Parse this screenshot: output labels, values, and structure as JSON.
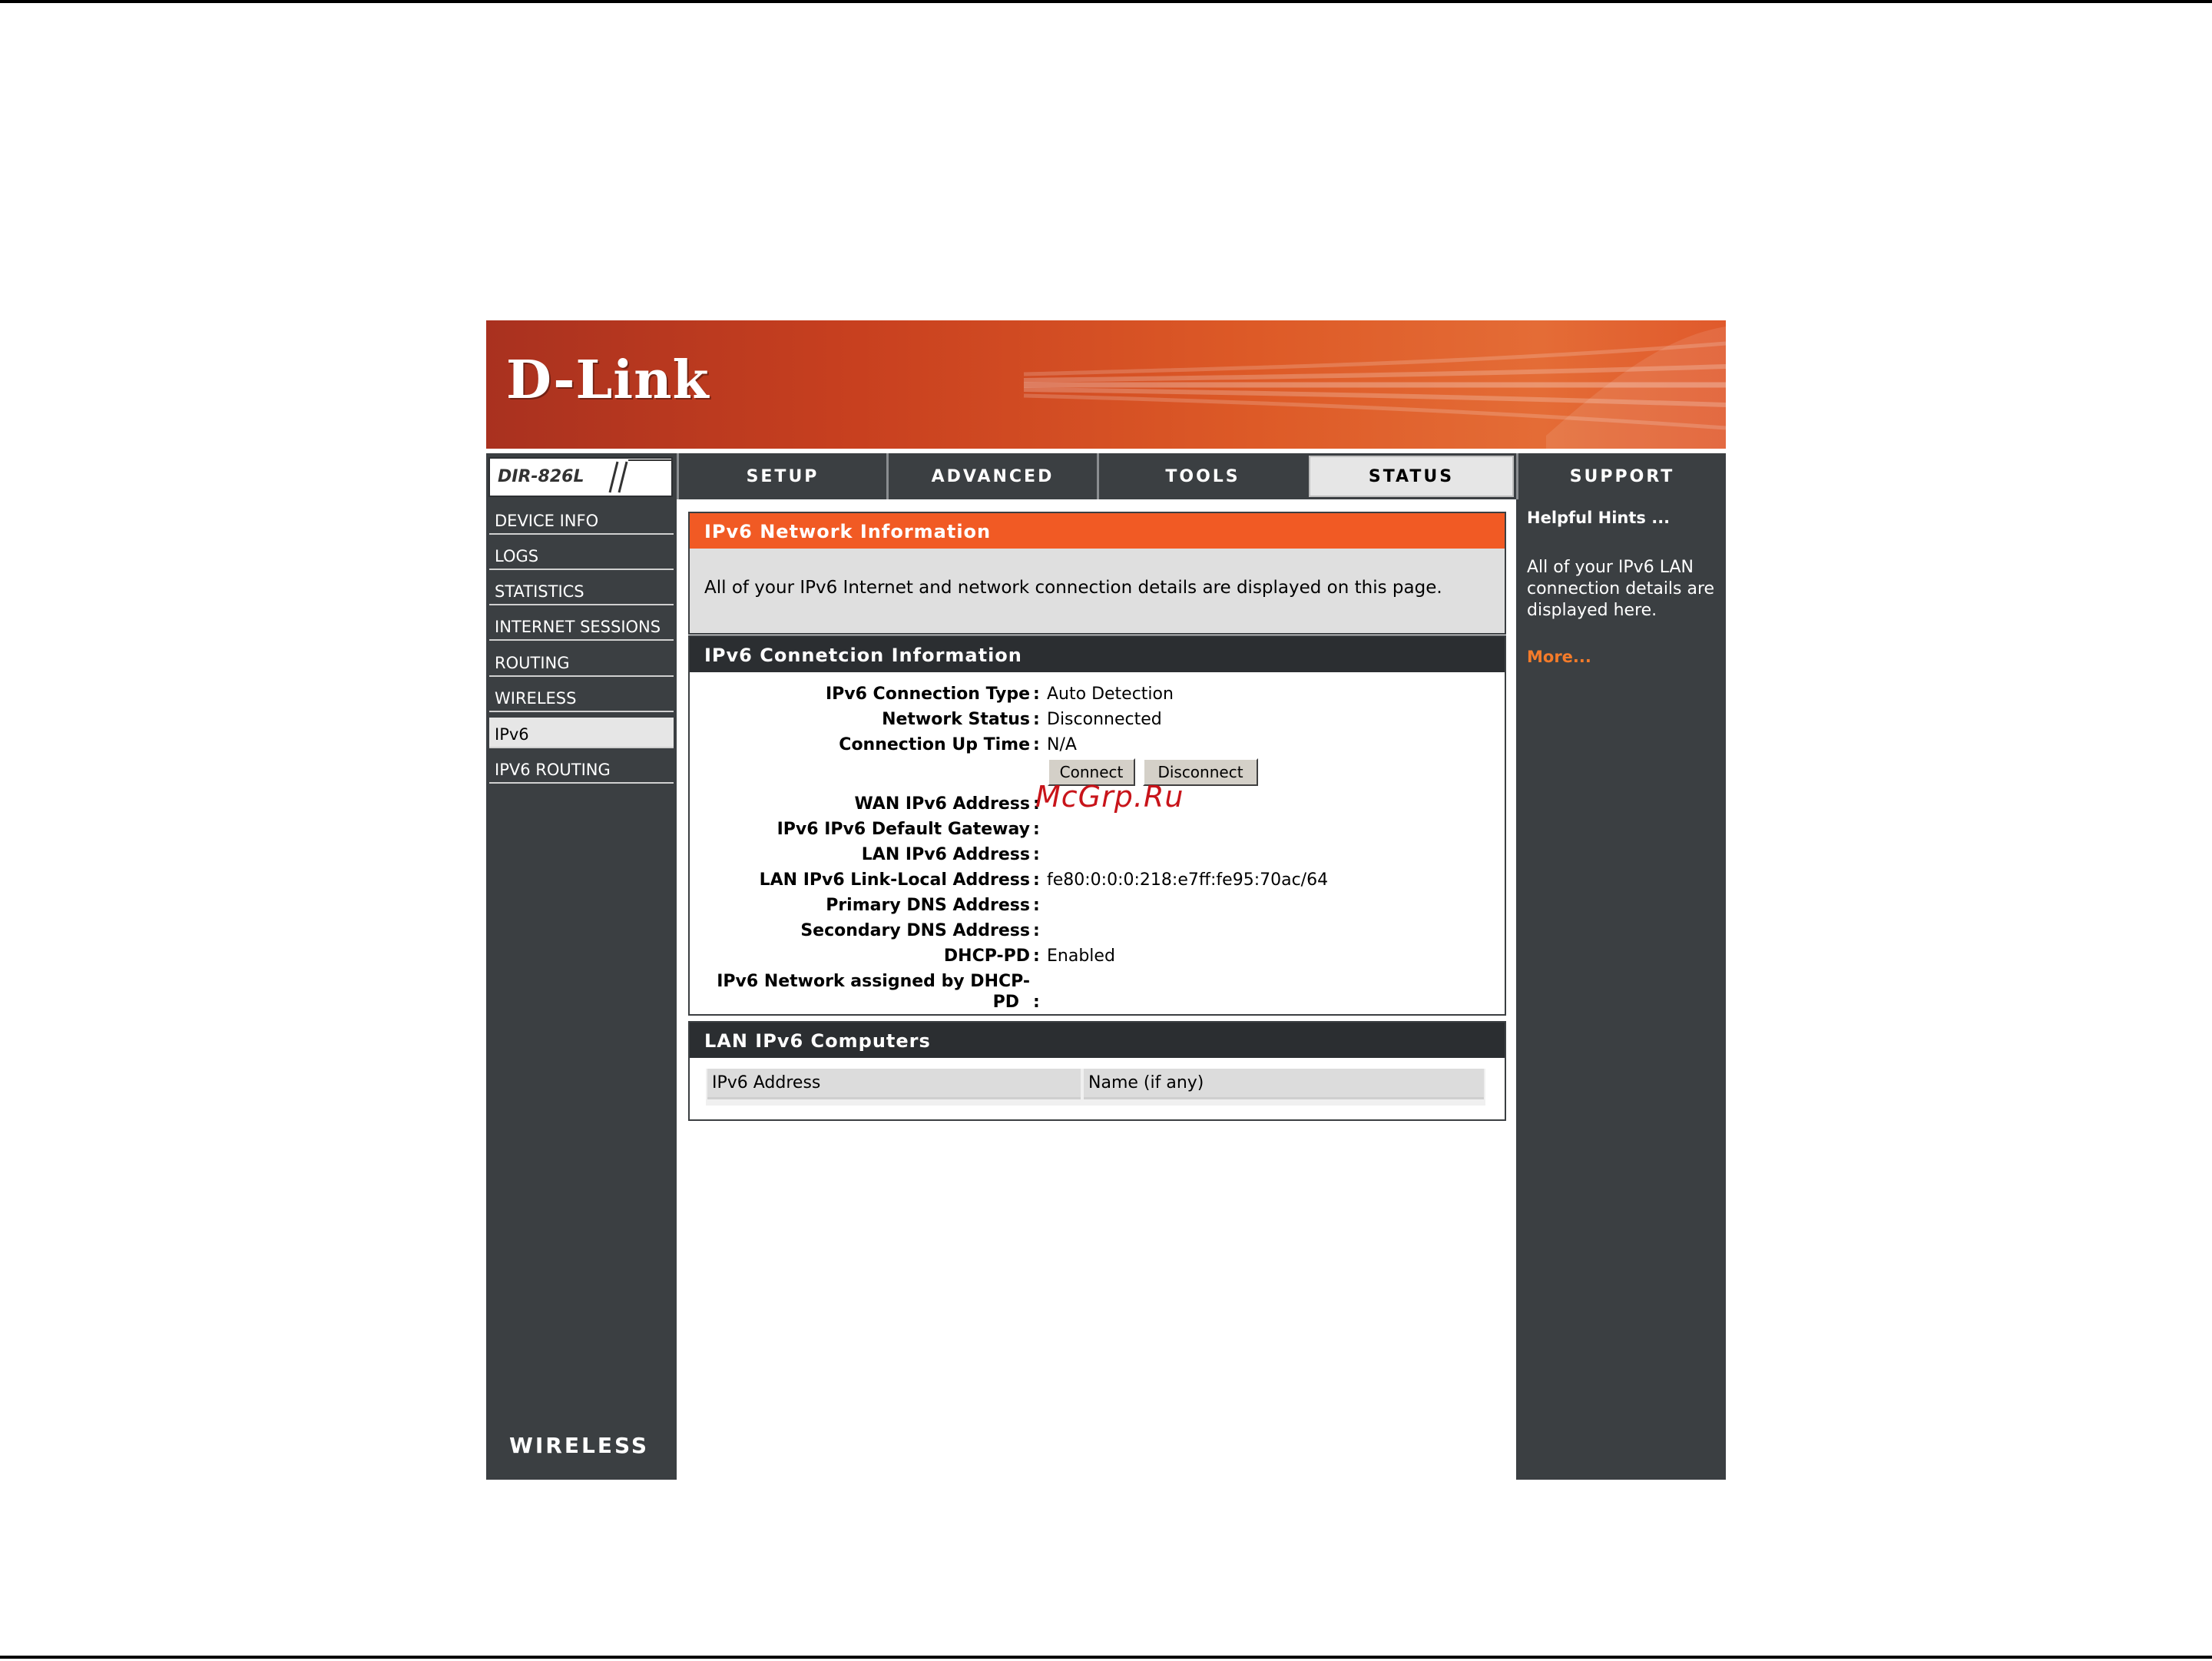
{
  "brand": {
    "logo_text": "D-Link",
    "model": "DIR-826L",
    "footer_text": "WIRELESS"
  },
  "tabs": [
    {
      "label": "SETUP",
      "active": false
    },
    {
      "label": "ADVANCED",
      "active": false
    },
    {
      "label": "TOOLS",
      "active": false
    },
    {
      "label": "STATUS",
      "active": true
    },
    {
      "label": "SUPPORT",
      "active": false
    }
  ],
  "sidebar": {
    "items": [
      {
        "label": "DEVICE INFO",
        "active": false
      },
      {
        "label": "LOGS",
        "active": false
      },
      {
        "label": "STATISTICS",
        "active": false
      },
      {
        "label": "INTERNET SESSIONS",
        "active": false
      },
      {
        "label": "ROUTING",
        "active": false
      },
      {
        "label": "WIRELESS",
        "active": false
      },
      {
        "label": "IPv6",
        "active": true
      },
      {
        "label": "IPV6 ROUTING",
        "active": false
      }
    ]
  },
  "network_info": {
    "title": "IPv6 Network Information",
    "description": "All of your IPv6 Internet and network connection details are displayed on this page."
  },
  "connection_info": {
    "title": "IPv6 Connetcion Information",
    "rows": [
      {
        "label": "IPv6 Connection Type",
        "value": "Auto Detection"
      },
      {
        "label": "Network Status",
        "value": "Disconnected"
      },
      {
        "label": "Connection Up Time",
        "value": "N/A"
      },
      {
        "label": "WAN IPv6 Address",
        "value": ""
      },
      {
        "label": "IPv6 IPv6 Default Gateway",
        "value": ""
      },
      {
        "label": "LAN IPv6 Address",
        "value": ""
      },
      {
        "label": "LAN IPv6 Link-Local Address",
        "value": "fe80:0:0:0:218:e7ff:fe95:70ac/64"
      },
      {
        "label": "Primary DNS Address",
        "value": ""
      },
      {
        "label": "Secondary DNS Address",
        "value": ""
      },
      {
        "label": "DHCP-PD",
        "value": "Enabled"
      },
      {
        "label": "IPv6 Network assigned by DHCP-",
        "label_line2": "PD",
        "value": ""
      }
    ],
    "connect_label": "Connect",
    "disconnect_label": "Disconnect",
    "watermark": "McGrp.Ru"
  },
  "lan_computers": {
    "title": "LAN IPv6 Computers",
    "columns": [
      "IPv6 Address",
      "Name (if any)"
    ]
  },
  "hints": {
    "title": "Helpful Hints ...",
    "text": "All of your IPv6 LAN connection details are displayed here.",
    "more": "More..."
  },
  "colors": {
    "accent": "#f15a24",
    "panel_dark": "#3b3f42",
    "link_orange": "#f47b2a",
    "watermark_red": "#c8141a"
  }
}
